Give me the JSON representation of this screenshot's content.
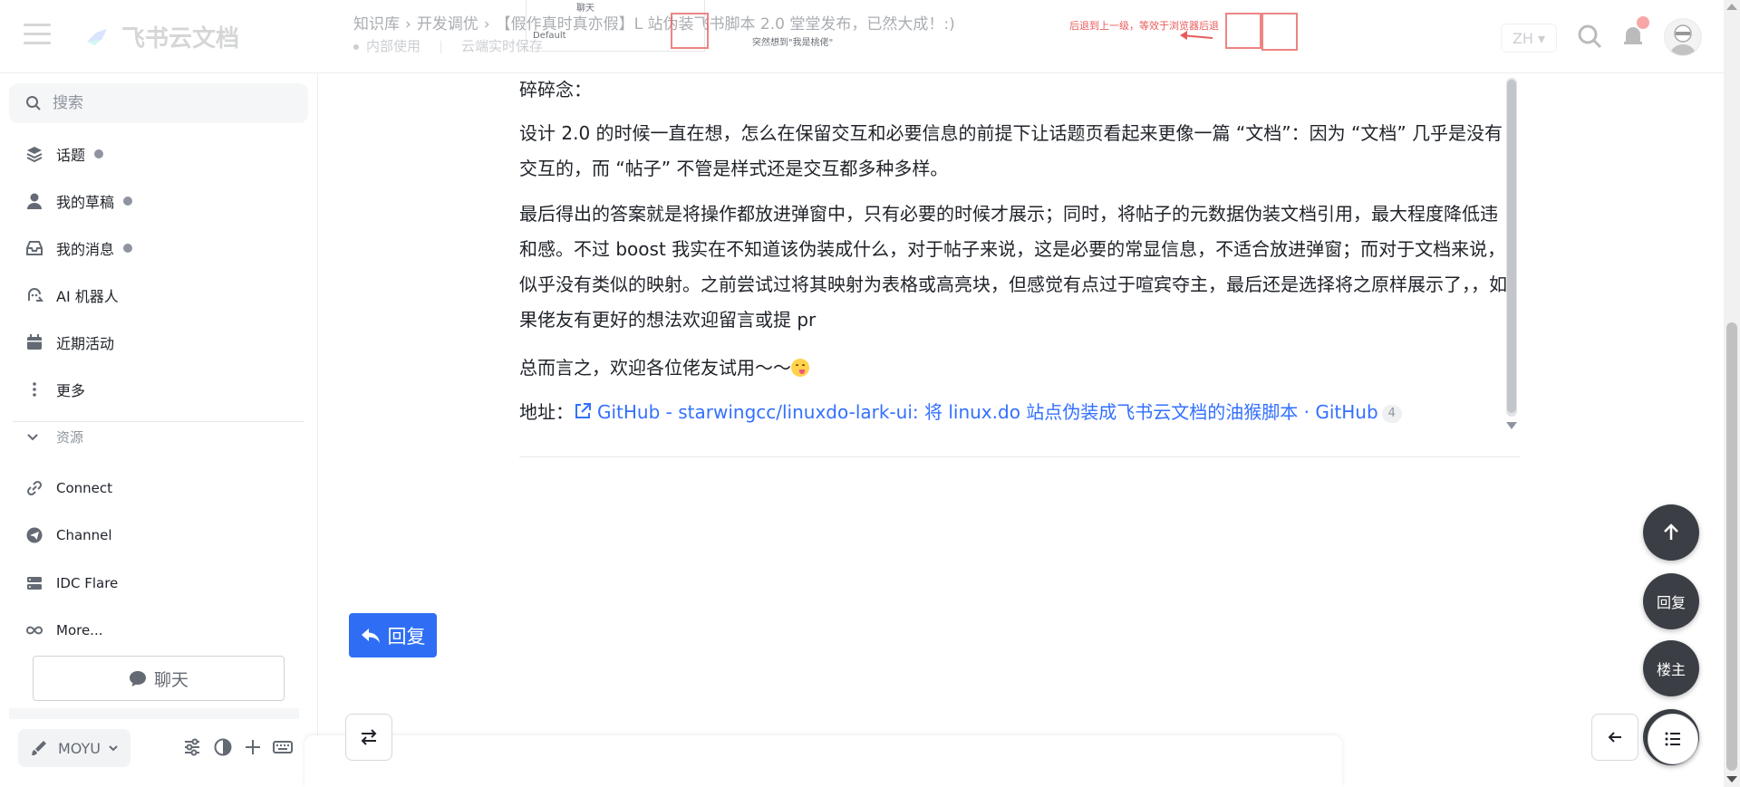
{
  "header": {
    "brand": "飞书云文档",
    "breadcrumb": [
      "知识库",
      "开发调优",
      "【假作真时真亦假】L 站伪装飞书脚本 2.0 堂堂发布，已然大成！:)"
    ],
    "meta_left": "内部使用",
    "meta_right": "云端实时保存",
    "lang": "ZH",
    "ghost_note": "后退到上一级，等效于浏览器后退",
    "ghost_note2": "突然想到\"我是桃佬\"",
    "ghost_chat": "聊天",
    "ghost_toolbar": "Default"
  },
  "sidebar": {
    "search_placeholder": "搜索",
    "items": [
      {
        "label": "话题",
        "icon": "layers-icon"
      },
      {
        "label": "我的草稿",
        "icon": "user-icon"
      },
      {
        "label": "我的消息",
        "icon": "inbox-icon"
      },
      {
        "label": "AI 机器人",
        "icon": "robot-icon"
      },
      {
        "label": "近期活动",
        "icon": "calendar-icon"
      },
      {
        "label": "更多",
        "icon": "more-vertical-icon"
      }
    ],
    "section_title": "资源",
    "resources": [
      {
        "label": "Connect",
        "icon": "link-icon"
      },
      {
        "label": "Channel",
        "icon": "telegram-icon"
      },
      {
        "label": "IDC Flare",
        "icon": "server-icon"
      },
      {
        "label": "More...",
        "icon": "infinity-icon"
      }
    ],
    "chat_button": "聊天",
    "theme_label": "MOYU"
  },
  "post": {
    "title": "碎碎念：",
    "p1": "设计 2.0 的时候一直在想，怎么在保留交互和必要信息的前提下让话题页看起来更像一篇 “文档”：因为 “文档” 几乎是没有交互的，而 “帖子” 不管是样式还是交互都多种多样。",
    "p2": "最后得出的答案就是将操作都放进弹窗中，只有必要的时候才展示；同时，将帖子的元数据伪装文档引用，最大程度降低违和感。不过 boost 我实在不知道该伪装成什么，对于帖子来说，这是必要的常显信息，不适合放进弹窗；而对于文档来说，似乎没有类似的映射。之前尝试过将其映射为表格或高亮块，但感觉有点过于喧宾夺主，最后还是选择将之原样展示了，，如果佬友有更好的想法欢迎留言或提 pr",
    "p3": "总而言之，欢迎各位佬友试用～～",
    "address_label": "地址：",
    "link_text": "GitHub - starwingcc/linuxdo-lark-ui: 将 linux.do 站点伪装成飞书云文档的油猴脚本 · GitHub",
    "link_clicks": "4"
  },
  "actions": {
    "reply": "回复",
    "fab_reply": "回复",
    "fab_op": "楼主"
  }
}
